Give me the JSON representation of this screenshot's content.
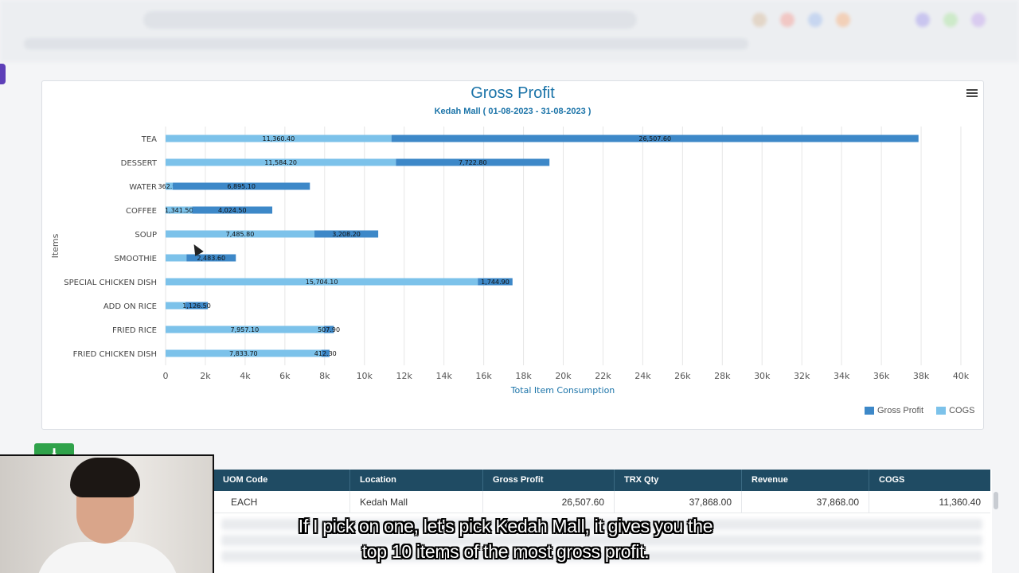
{
  "chart_data": {
    "type": "bar",
    "orientation": "horizontal",
    "stacked": true,
    "title": "Gross Profit",
    "subtitle": "Kedah Mall ( 01-08-2023 - 31-08-2023 )",
    "xlabel": "Total Item Consumption",
    "ylabel": "Items",
    "xlim": [
      0,
      40000
    ],
    "x_ticks": [
      "0",
      "2k",
      "4k",
      "6k",
      "8k",
      "10k",
      "12k",
      "14k",
      "16k",
      "18k",
      "20k",
      "22k",
      "24k",
      "26k",
      "28k",
      "30k",
      "32k",
      "34k",
      "36k",
      "38k",
      "40k"
    ],
    "grid": true,
    "legend_position": "bottom-right",
    "categories": [
      "TEA",
      "DESSERT",
      "WATER",
      "COFFEE",
      "SOUP",
      "SMOOTHIE",
      "SPECIAL CHICKEN DISH",
      "ADD ON RICE",
      "FRIED RICE",
      "FRIED CHICKEN DISH"
    ],
    "series": [
      {
        "name": "COGS",
        "color": "#7cc2ea",
        "values": [
          11360.4,
          11584.2,
          362.9,
          1341.5,
          7485.8,
          1050,
          15704.1,
          1000,
          7957.1,
          7833.7
        ],
        "labels": [
          "11,360.40",
          "11,584.20",
          "362.90",
          "1,341.50",
          "7,485.80",
          "",
          "15,704.10",
          "",
          "7,957.10",
          "7,833.70"
        ]
      },
      {
        "name": "Gross Profit",
        "color": "#3d88c8",
        "values": [
          26507.6,
          7722.8,
          6895.1,
          4024.5,
          3208.2,
          2483.6,
          1744.9,
          1126.5,
          507.9,
          412.3
        ],
        "labels": [
          "26,507.60",
          "7,722.80",
          "6,895.10",
          "4,024.50",
          "3,208.20",
          "2,483.60",
          "1,744.90",
          "1,126.50",
          "507.90",
          "412.30"
        ]
      }
    ]
  },
  "legend": {
    "gross_profit": "Gross Profit",
    "cogs": "COGS"
  },
  "colors": {
    "gross_profit": "#3d88c8",
    "cogs": "#7cc2ea",
    "title": "#1a73a8",
    "table_header": "#1f4b63"
  },
  "toolbar": {
    "download_icon": "download-icon",
    "download_glyph": "⬇"
  },
  "table": {
    "columns": [
      "UOM Code",
      "Location",
      "Gross Profit",
      "TRX Qty",
      "Revenue",
      "COGS"
    ],
    "rows": [
      [
        "EACH",
        "Kedah Mall",
        "26,507.60",
        "37,868.00",
        "37,868.00",
        "11,360.40"
      ]
    ]
  },
  "subtitles": {
    "line1": "If I pick on one, let's pick Kedah Mall, it gives you the",
    "line2": "top 10 items of  the most gross profit."
  }
}
